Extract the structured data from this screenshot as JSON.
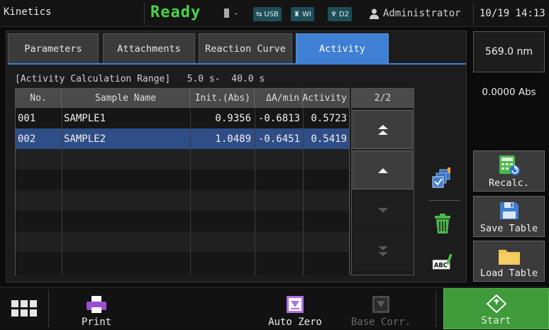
{
  "topbar": {
    "app_title": "Kinetics",
    "status": "Ready",
    "cell_indicator": "-",
    "chips": [
      {
        "icon": "usb-icon",
        "label": "USB"
      },
      {
        "icon": "wi-icon",
        "label": "WI"
      },
      {
        "icon": "d2-lamp-icon",
        "label": "D2"
      }
    ],
    "user": "Administrator",
    "datetime": "10/19 14:13"
  },
  "tabs": [
    {
      "label": "Parameters",
      "active": false
    },
    {
      "label": "Attachments",
      "active": false
    },
    {
      "label": "Reaction Curve",
      "active": false
    },
    {
      "label": "Activity",
      "active": true
    }
  ],
  "range_text": "[Activity Calculation Range]   5.0 s-  40.0 s",
  "table": {
    "columns": [
      "No.",
      "Sample Name",
      "Init.(Abs)",
      "ΔA/min",
      "Activity"
    ],
    "rows": [
      {
        "no": "001",
        "name": "SAMPLE1",
        "init": "0.9356",
        "dA": "-0.6813",
        "activity": "0.5723",
        "selected": false
      },
      {
        "no": "002",
        "name": "SAMPLE2",
        "init": "1.0489",
        "dA": "-0.6451",
        "activity": "0.5419",
        "selected": true
      }
    ]
  },
  "pager": {
    "page": "2/2"
  },
  "side": {
    "wavelength": "569.0 nm",
    "absorbance": "0.0000 Abs",
    "recalc_label": "Recalc.",
    "save_table_label": "Save Table",
    "load_table_label": "Load Table"
  },
  "bottom": {
    "print_label": "Print",
    "auto_zero_label": "Auto Zero",
    "base_corr_label": "Base Corr.",
    "start_label": "Start"
  },
  "colors": {
    "accent": "#3f7fd4",
    "status": "#4cd24c",
    "start": "#3f9a3a",
    "selected_row": "#2f4d86"
  }
}
